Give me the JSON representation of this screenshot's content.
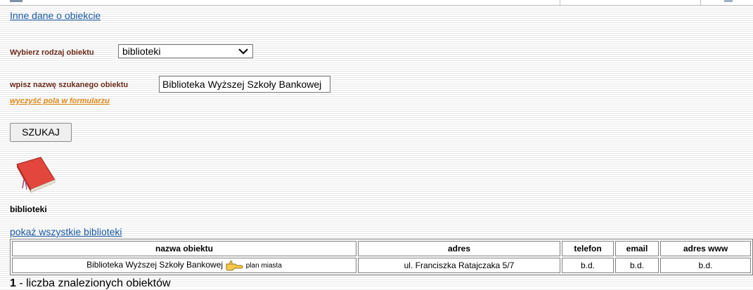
{
  "top_link": "Inne dane o obiekcie",
  "form": {
    "type_label": "Wybierz rodzaj obiektu",
    "type_value": "biblioteki",
    "name_label": "wpisz nazwę szukanego obiektu",
    "name_value": "Biblioteka Wyższej Szkoły Bankowej",
    "clear_link": "wyczyść pola w formularzu",
    "search_button": "SZUKAJ"
  },
  "category": {
    "icon": "book-icon",
    "title": "biblioteki",
    "show_all_link": "pokaż wszystkie biblioteki"
  },
  "table": {
    "headers": [
      "nazwa obiektu",
      "adres",
      "telefon",
      "email",
      "adres www"
    ],
    "rows": [
      {
        "name": "Biblioteka Wyższej Szkoły Bankowej",
        "map_icon": "pointing-hand-icon",
        "map_link": "plan miasta",
        "address": "ul. Franciszka Ratajczaka 5/7",
        "phone": "b.d.",
        "email": "b.d.",
        "www": "b.d."
      }
    ]
  },
  "result_count": {
    "number": "1",
    "text": " - liczba znalezionych obiektów"
  },
  "colors": {
    "link": "#1a5aa6",
    "label": "#6b2c1a",
    "clear_link": "#e08a1a",
    "book": "#e2463c"
  }
}
